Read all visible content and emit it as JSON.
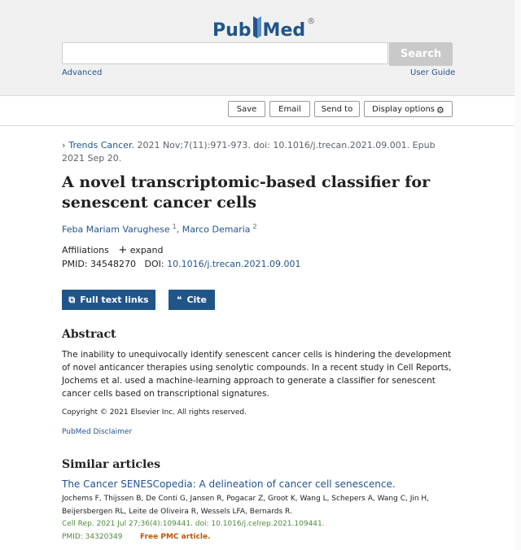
{
  "header": {
    "logo_pub": "Pub",
    "logo_med": "Med",
    "logo_reg": "®",
    "search_value": "",
    "search_button": "Search",
    "advanced_link": "Advanced",
    "user_guide_link": "User Guide"
  },
  "toolbar": {
    "save": "Save",
    "email": "Email",
    "send_to": "Send to",
    "display_options": "Display options"
  },
  "article": {
    "journal": "Trends Cancer.",
    "citation_rest": " 2021 Nov;7(11):971-973. doi: 10.1016/j.trecan.2021.09.001. Epub 2021 Sep 20.",
    "title": "A novel transcriptomic-based classifier for senescent cancer cells",
    "authors": [
      {
        "name": "Feba Mariam Varughese",
        "sup": "1"
      },
      {
        "name": "Marco Demaria",
        "sup": "2"
      }
    ],
    "author_sep": ",",
    "affiliations_label": "Affiliations",
    "expand_label": "expand",
    "pmid_label": "PMID: 34548270",
    "doi_label": "DOI:",
    "doi_value": "10.1016/j.trecan.2021.09.001"
  },
  "actions": {
    "full_text": "Full text links",
    "cite": "Cite"
  },
  "abstract": {
    "heading": "Abstract",
    "text": "The inability to unequivocally identify senescent cancer cells is hindering the development of novel anticancer therapies using senolytic compounds. In a recent study in Cell Reports, Jochems et al. used a machine-learning approach to generate a classifier for senescent cancer cells based on transcriptional signatures.",
    "copyright": "Copyright © 2021 Elsevier Inc. All rights reserved.",
    "disclaimer": "PubMed Disclaimer"
  },
  "similar": {
    "heading": "Similar articles",
    "items": [
      {
        "title": "The Cancer SENESCopedia: A delineation of cancer cell senescence.",
        "authors": "Jochems F, Thijssen B, De Conti G, Jansen R, Pogacar Z, Groot K, Wang L, Schepers A, Wang C, Jin H, Beijersbergen RL, Leite de Oliveira R, Wessels LFA, Bernards R.",
        "citation": "Cell Rep. 2021 Jul 27;36(4):109441. doi: 10.1016/j.celrep.2021.109441.",
        "pmid": "PMID: 34320349",
        "free": "Free PMC article."
      }
    ]
  },
  "icons": {
    "chevron": "›",
    "plus": "+",
    "gear": "⚙",
    "external": "⧉",
    "quote": "❝"
  },
  "colors": {
    "brand": "#20558a",
    "link": "#205493",
    "green": "#4e8a3e",
    "orange": "#c05600"
  }
}
